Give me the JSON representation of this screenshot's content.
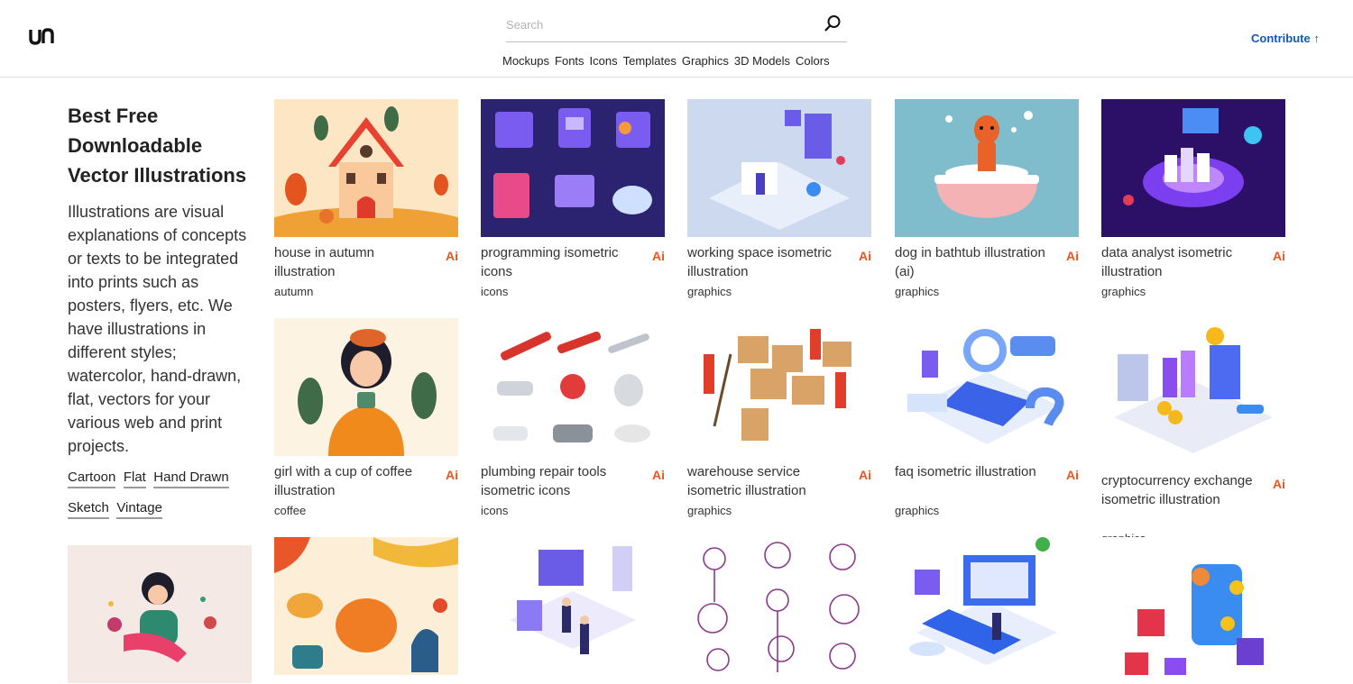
{
  "header": {
    "logo_text": "un",
    "search_placeholder": "Search",
    "nav": [
      "Mockups",
      "Fonts",
      "Icons",
      "Templates",
      "Graphics",
      "3D Models",
      "Colors"
    ],
    "contribute_label": "Contribute ↑"
  },
  "sidebar": {
    "title": "Best Free Downloadable Vector Illustrations",
    "description": "Illustrations are visual explanations of concepts or texts to be integrated into prints such as posters, flyers, etc. We have illustrations in different styles; watercolor, hand-drawn, flat, vectors for your various web and print projects.",
    "tags": [
      "Cartoon",
      "Flat",
      "Hand Drawn",
      "Sketch",
      "Vintage"
    ]
  },
  "cards": [
    {
      "title": "house in autumn illustration",
      "category": "autumn",
      "badge": "Ai",
      "bg": "#fde6c4"
    },
    {
      "title": "programming isometric icons",
      "category": "icons",
      "badge": "Ai",
      "bg": "#2b2370"
    },
    {
      "title": "working space isometric illustration",
      "category": "graphics",
      "badge": "Ai",
      "bg": "#cdd9ee"
    },
    {
      "title": "dog in bathtub illustration (ai)",
      "category": "graphics",
      "badge": "Ai",
      "bg": "#7fbccc"
    },
    {
      "title": "data analyst isometric illustration",
      "category": "graphics",
      "badge": "Ai",
      "bg": "#2c1067"
    },
    {
      "title": "girl with a cup of coffee illustration",
      "category": "coffee",
      "badge": "Ai",
      "bg": "#fdf3e3"
    },
    {
      "title": "plumbing repair tools isometric icons",
      "category": "icons",
      "badge": "Ai",
      "bg": "#ffffff"
    },
    {
      "title": "warehouse service isometric illustration",
      "category": "graphics",
      "badge": "Ai",
      "bg": "#ffffff"
    },
    {
      "title": "faq isometric illustration",
      "category": "graphics",
      "badge": "Ai",
      "bg": "#ffffff"
    },
    {
      "title": "cryptocurrency exchange isometric illustration",
      "category": "graphics",
      "badge": "Ai",
      "bg": "#ffffff"
    }
  ],
  "row3": [
    {
      "bg": "#fdeed7"
    },
    {
      "bg": "#ffffff"
    },
    {
      "bg": "#ffffff"
    },
    {
      "bg": "#ffffff"
    },
    {
      "bg": "#ffffff"
    }
  ],
  "colors": {
    "accent": "#1557b0",
    "badge": "#e8561d"
  }
}
